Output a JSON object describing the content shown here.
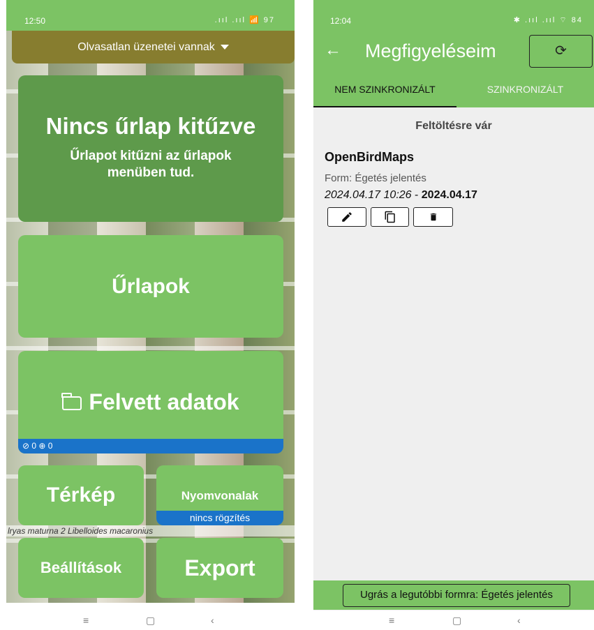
{
  "left": {
    "status_time": "12:50",
    "status_icons": "⏰ ⓐ 🗑",
    "status_right": ".ııl .ııl 📶 97",
    "notification": "Olvasatlan üzenetei vannak",
    "pin_card": {
      "title": "Nincs űrlap kitűzve",
      "subtitle": "Űrlapot kitűzni az űrlapok menüben tud."
    },
    "forms_label": "Űrlapok",
    "data_label": "Felvett adatok",
    "data_counts": "⊘ 0 ⊕ 0",
    "map_label": "Térkép",
    "tracks_label": "Nyomvonalak",
    "tracks_status": "nincs rögzítés",
    "settings_label": "Beállítások",
    "export_label": "Export",
    "background_text": "lryas maturna 2   Libelloides macaronius",
    "nav": {
      "menu": "≡",
      "home": "▢",
      "back": "‹"
    }
  },
  "right": {
    "status_time": "12:04",
    "status_icons": "⏰",
    "status_right": "✱ .ııl .ııl ⌔ 84",
    "back_icon": "←",
    "title": "Megfigyeléseim",
    "sync_icon": "⟳",
    "tabs": [
      {
        "label": "NEM SZINKRONIZÁLT"
      },
      {
        "label": "SZINKRONIZÁLT"
      }
    ],
    "section_title": "Feltöltésre vár",
    "observation": {
      "title": "OpenBirdMaps",
      "form": "Form: Égetés jelentés",
      "date_start": "2024.04.17 10:26",
      "date_sep": " - ",
      "date_end": "2024.04.17"
    },
    "actions": [
      {
        "icon": "edit-icon"
      },
      {
        "icon": "copy-icon"
      },
      {
        "icon": "delete-icon"
      }
    ],
    "jump_label": "Ugrás a legutóbbi formra: Égetés jelentés",
    "nav": {
      "menu": "≡",
      "home": "▢",
      "back": "‹"
    }
  },
  "colors": {
    "green": "#7cc364",
    "dark_green": "#5e9a4b",
    "olive": "#877d2f",
    "blue": "#1a73c9"
  }
}
